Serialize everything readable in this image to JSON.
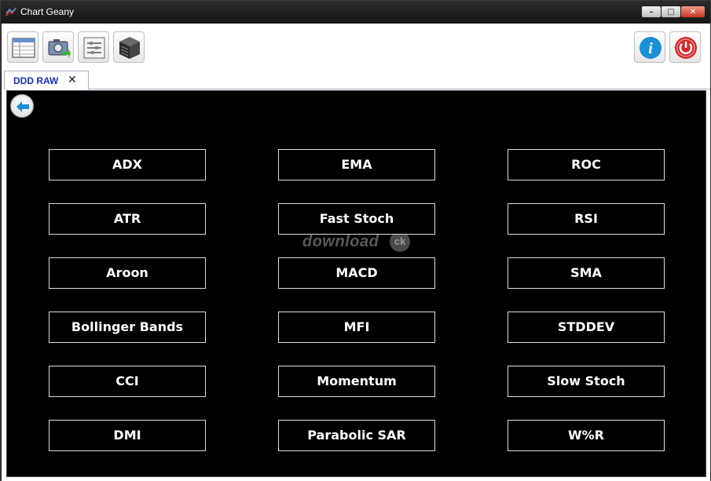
{
  "window": {
    "title": "Chart Geany",
    "controls": {
      "minimize": "–",
      "maximize": "□",
      "close": "✕"
    }
  },
  "toolbar": {
    "left_tools": [
      {
        "icon": "spreadsheet-icon"
      },
      {
        "icon": "screenshot-icon"
      },
      {
        "icon": "settings-panel-icon"
      },
      {
        "icon": "database-server-icon"
      }
    ],
    "right_tools": [
      {
        "icon": "info-icon"
      },
      {
        "icon": "power-icon"
      }
    ]
  },
  "tab": {
    "label": "DDD RAW",
    "close_glyph": "✕"
  },
  "panel": {
    "background": "#000000",
    "back_icon": "back-arrow-icon"
  },
  "indicators": {
    "col1": [
      "ADX",
      "ATR",
      "Aroon",
      "Bollinger Bands",
      "CCI",
      "DMI"
    ],
    "col2": [
      "EMA",
      "Fast Stoch",
      "MACD",
      "MFI",
      "Momentum",
      "Parabolic SAR"
    ],
    "col3": [
      "ROC",
      "RSI",
      "SMA",
      "STDDEV",
      "Slow Stoch",
      "W%R"
    ]
  },
  "watermark": {
    "text": "download",
    "badge": "ck"
  },
  "colors": {
    "tab_label": "#1a2fbf",
    "info": "#1a8fd6",
    "power": "#d42a2a"
  }
}
